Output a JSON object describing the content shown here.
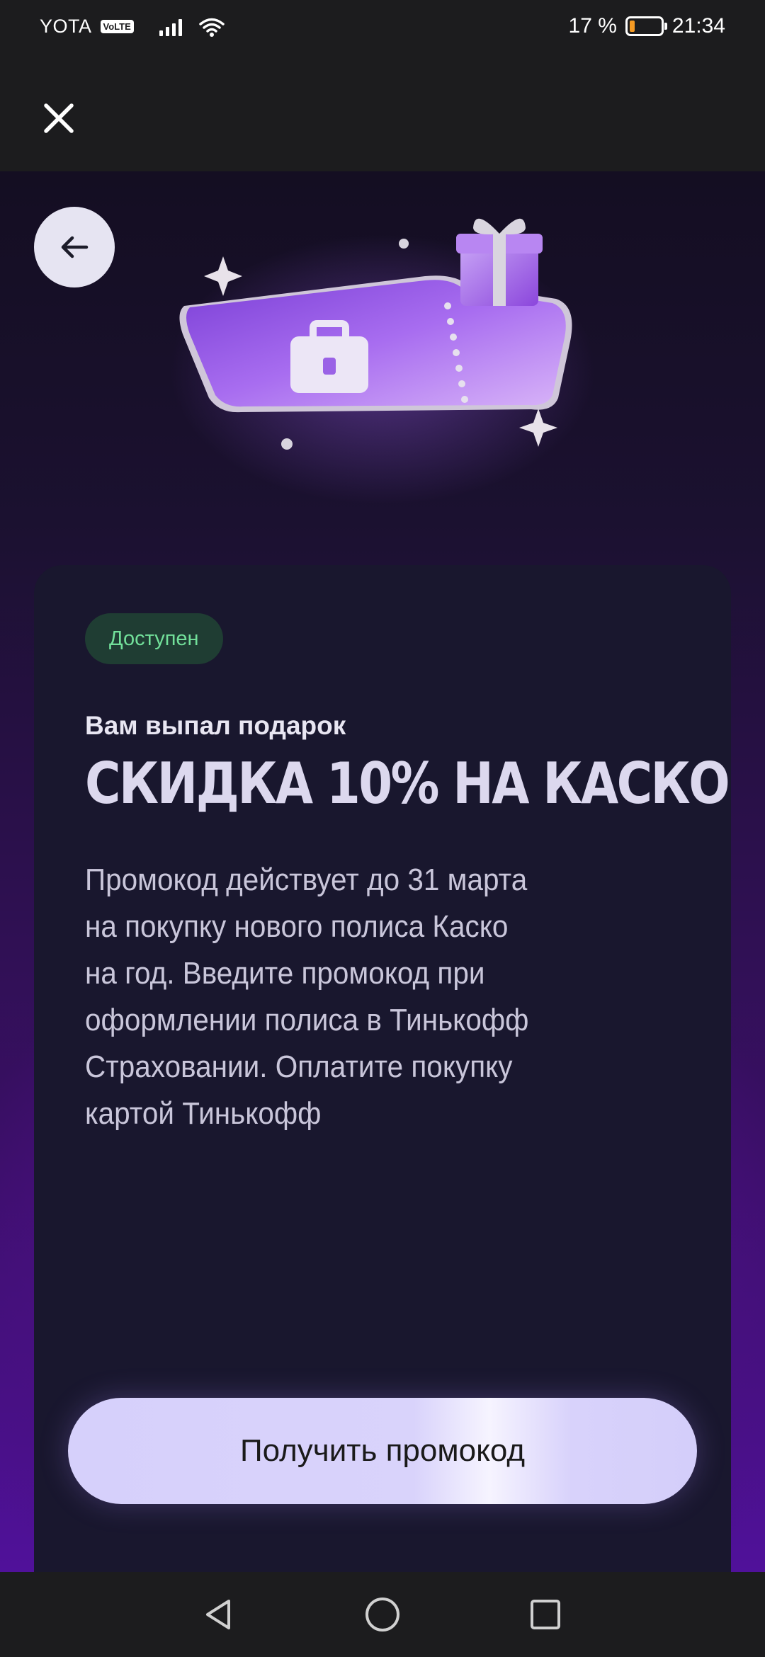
{
  "status_bar": {
    "carrier": "YOTA",
    "volte": "VoLTE",
    "battery_text": "17 %",
    "battery_level": 0.17,
    "time": "21:34",
    "battery_color": "#f59a23"
  },
  "top_bar": {
    "close_icon": "close-icon"
  },
  "hero": {
    "back_icon": "arrow-left-icon",
    "illustration": "gift-ticket-illustration"
  },
  "card": {
    "badge": "Доступен",
    "subtitle": "Вам выпал подарок",
    "title": "СКИДКА 10% НА КАСКО",
    "description_lines": [
      "Промокод действует до 31 марта",
      "на покупку нового полиса Каско",
      "на год. Введите промокод при",
      "оформлении полиса в Тинькофф",
      "Страховании. Оплатите покупку",
      "картой Тинькофф"
    ]
  },
  "action": {
    "label": "Получить промокод"
  },
  "colors": {
    "card_bg": "#19172e",
    "badge_bg": "#1f3d33",
    "badge_text": "#72e09a",
    "button_bg": "#d6d0fb",
    "accent_purple": "#6d16b5"
  },
  "nav_bar": {
    "back": "triangle-back-icon",
    "home": "circle-home-icon",
    "recents": "square-recents-icon"
  }
}
